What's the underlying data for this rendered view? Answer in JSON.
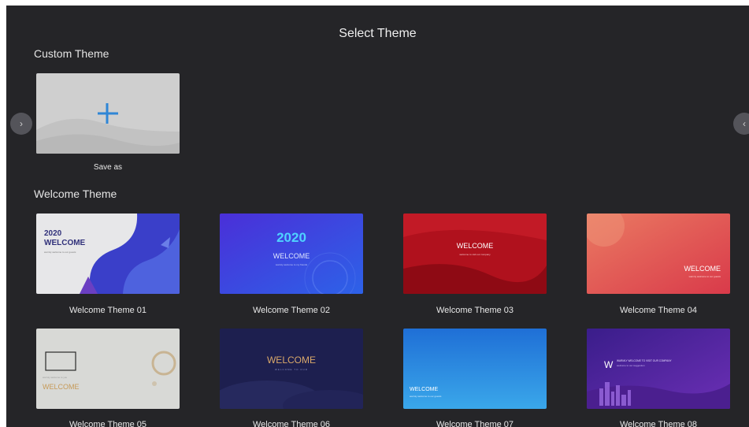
{
  "header": {
    "title": "Select Theme"
  },
  "nav": {
    "prev_icon": "›",
    "next_icon": "‹"
  },
  "custom": {
    "section_title": "Custom Theme",
    "save_card": {
      "icon": "plus-icon",
      "caption": "Save as"
    }
  },
  "welcome": {
    "section_title": "Welcome Theme",
    "themes": [
      {
        "caption": "Welcome Theme 01",
        "year": "2020",
        "headline": "WELCOME",
        "sub": "warmly welcome to our guests"
      },
      {
        "caption": "Welcome Theme 02",
        "year": "2020",
        "headline": "WELCOME",
        "sub": "warmly welcome to my friends"
      },
      {
        "caption": "Welcome Theme 03",
        "headline": "WELCOME",
        "sub": "welcome to visit our company"
      },
      {
        "caption": "Welcome Theme 04",
        "headline": "WELCOME",
        "sub": "warmly welcome to our guests"
      },
      {
        "caption": "Welcome Theme 05",
        "headline": "WELCOME",
        "sub": "warmly welcome to you"
      },
      {
        "caption": "Welcome Theme 06",
        "headline": "WELCOME",
        "sub": "WELCOME TO OUR"
      },
      {
        "caption": "Welcome Theme 07",
        "headline": "WELCOME",
        "sub": "warmly welcome to our guests"
      },
      {
        "caption": "Welcome Theme 08",
        "letter": "W",
        "headline": "WARMLY WELCOME TO VISIT OUR COMPANY",
        "sub": "welcome to our suggestion"
      }
    ]
  },
  "colors": {
    "background": "#252528",
    "accent_plus": "#2f86d6"
  }
}
